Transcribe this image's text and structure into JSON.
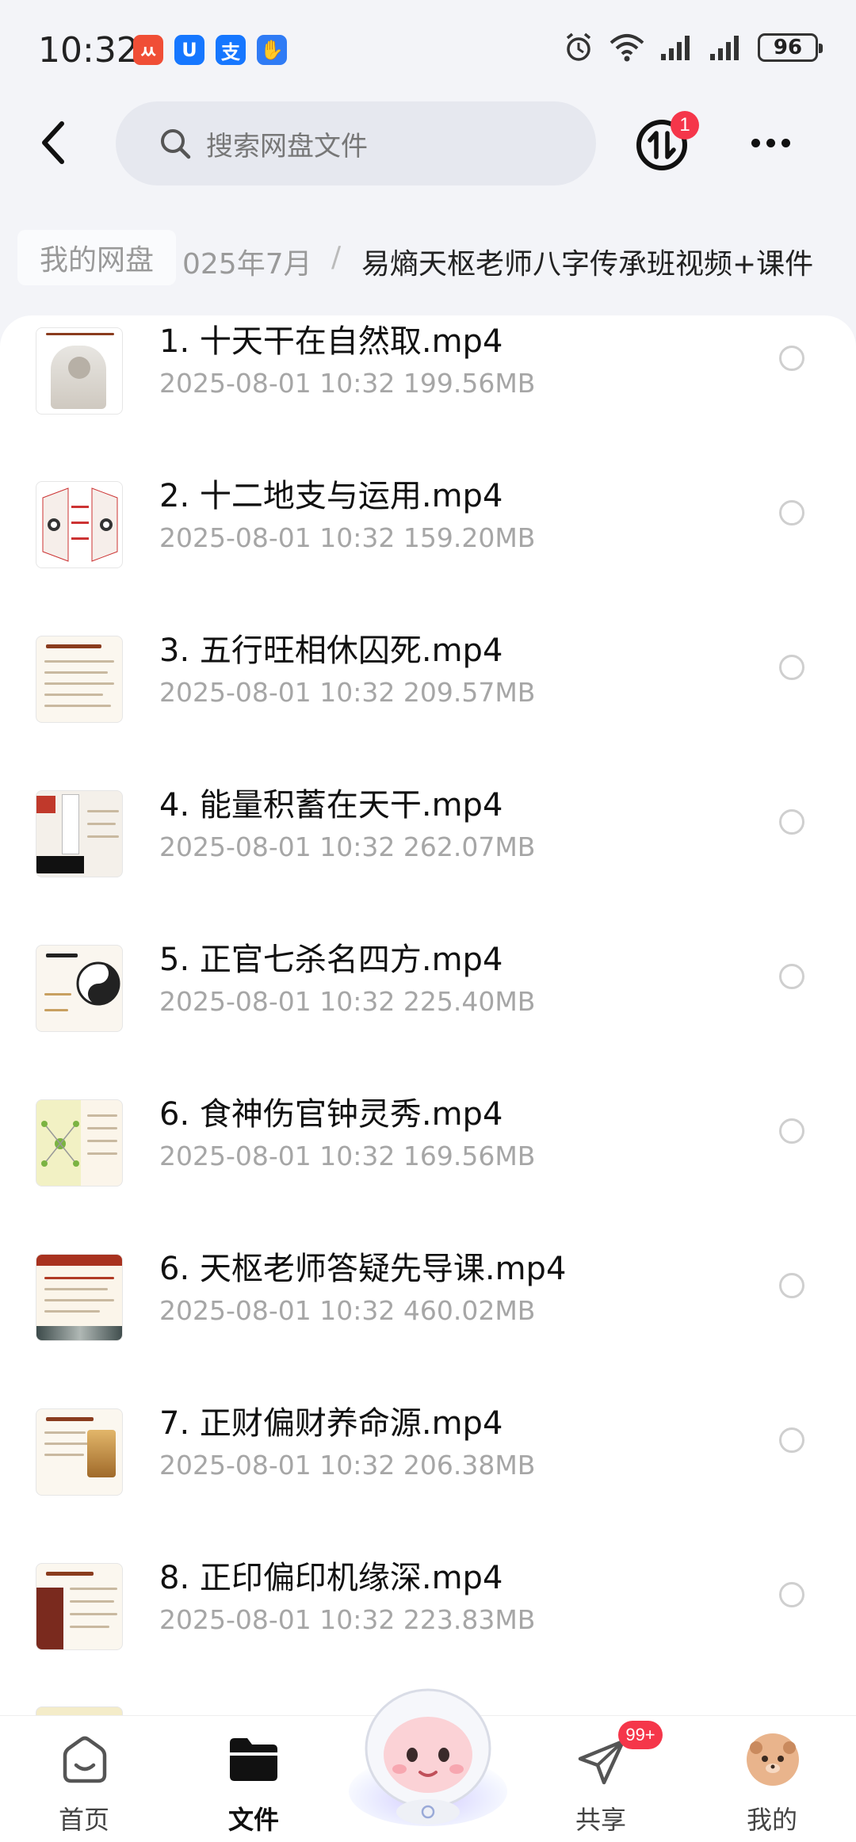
{
  "status_bar": {
    "time": "10:32",
    "apps": [
      {
        "icon": "xiaohongshu-like-app-icon",
        "glyph": "ㅆ",
        "color": "#f04e36"
      },
      {
        "icon": "u-app-icon",
        "glyph": "U",
        "color": "#1677ff"
      },
      {
        "icon": "alipay-icon",
        "glyph": "支",
        "color": "#1677ff"
      },
      {
        "icon": "hand-app-icon",
        "glyph": "✋",
        "color": "#2f7bf5"
      }
    ],
    "battery": "96"
  },
  "header": {
    "search_placeholder": "搜索网盘文件",
    "transfer_badge": "1"
  },
  "breadcrumb": {
    "root": "我的网盘",
    "middle": "025年7月",
    "separator": "/",
    "current": "易熵天枢老师八字传承班视频+课件"
  },
  "files": [
    {
      "name": "1. 十天干在自然取.mp4",
      "meta": "2025-08-01  10:32  199.56MB",
      "thumb": "statue"
    },
    {
      "name": "2. 十二地支与运用.mp4",
      "meta": "2025-08-01  10:32  159.20MB",
      "thumb": "bagua"
    },
    {
      "name": "3. 五行旺相休囚死.mp4",
      "meta": "2025-08-01  10:32  209.57MB",
      "thumb": "text"
    },
    {
      "name": "4. 能量积蓄在天干.mp4",
      "meta": "2025-08-01  10:32  262.07MB",
      "thumb": "chart"
    },
    {
      "name": "5. 正官七杀名四方.mp4",
      "meta": "2025-08-01  10:32  225.40MB",
      "thumb": "taiji"
    },
    {
      "name": "6. 食神伤官钟灵秀.mp4",
      "meta": "2025-08-01  10:32  169.56MB",
      "thumb": "mindmap"
    },
    {
      "name": "6. 天枢老师答疑先导课.mp4",
      "meta": "2025-08-01  10:32  460.02MB",
      "thumb": "slide"
    },
    {
      "name": "7. 正财偏财养命源.mp4",
      "meta": "2025-08-01  10:32  206.38MB",
      "thumb": "text2"
    },
    {
      "name": "8. 正印偏印机缘深.mp4",
      "meta": "2025-08-01  10:32  223.83MB",
      "thumb": "text3"
    }
  ],
  "bottom_nav": {
    "items": [
      {
        "label": "首页",
        "icon": "home-icon",
        "active": false
      },
      {
        "label": "文件",
        "icon": "folder-icon",
        "active": true
      },
      {
        "label": "共享",
        "icon": "share-plane-icon",
        "active": false,
        "badge": "99+"
      },
      {
        "label": "我的",
        "icon": "avatar",
        "active": false
      }
    ]
  },
  "colors": {
    "accent_red": "#f5364a",
    "text_primary": "#111111",
    "text_secondary": "#a6a6a6",
    "background": "#f3f4f8"
  }
}
